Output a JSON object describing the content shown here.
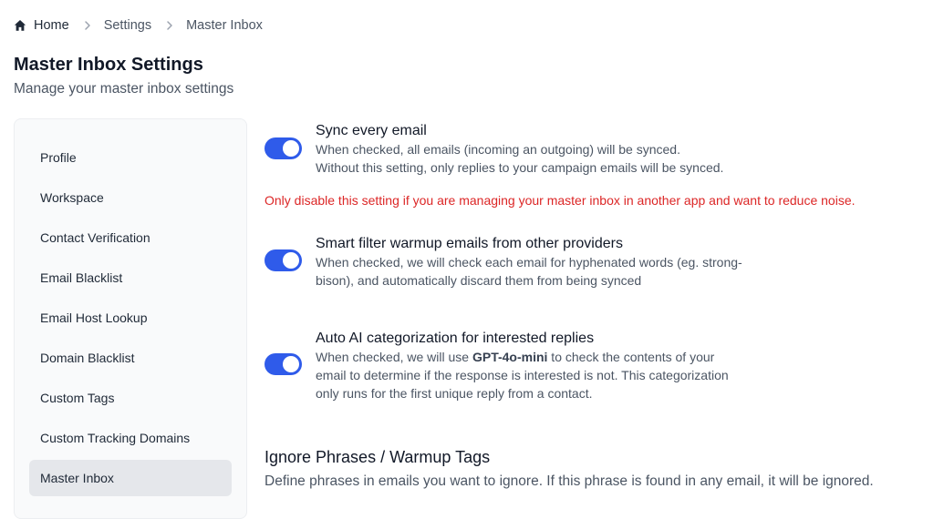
{
  "breadcrumb": {
    "home": "Home",
    "settings": "Settings",
    "current": "Master Inbox"
  },
  "header": {
    "title": "Master Inbox Settings",
    "subtitle": "Manage your master inbox settings"
  },
  "sidebar": {
    "items": [
      {
        "label": "Profile",
        "active": false
      },
      {
        "label": "Workspace",
        "active": false
      },
      {
        "label": "Contact Verification",
        "active": false
      },
      {
        "label": "Email Blacklist",
        "active": false
      },
      {
        "label": "Email Host Lookup",
        "active": false
      },
      {
        "label": "Domain Blacklist",
        "active": false
      },
      {
        "label": "Custom Tags",
        "active": false
      },
      {
        "label": "Custom Tracking Domains",
        "active": false
      },
      {
        "label": "Master Inbox",
        "active": true
      }
    ]
  },
  "settings": {
    "sync": {
      "enabled": true,
      "title": "Sync every email",
      "desc_line1": "When checked, all emails (incoming an outgoing) will be synced.",
      "desc_line2": "Without this setting, only replies to your campaign emails will be synced."
    },
    "warning": "Only disable this setting if you are managing your master inbox in another app and want to reduce noise.",
    "smart_filter": {
      "enabled": true,
      "title": "Smart filter warmup emails from other providers",
      "desc_line1": "When checked, we will check each email for hyphenated words (eg. strong-",
      "desc_line2": "bison), and automatically discard them from being synced"
    },
    "auto_ai": {
      "enabled": true,
      "title": "Auto AI categorization for interested replies",
      "desc_line1_pre": "When checked, we will use ",
      "desc_line1_model": "GPT-4o-mini",
      "desc_line1_post": " to check the contents of your",
      "desc_line2": "email to determine if the response is interested is not. This categorization",
      "desc_line3": "only runs for the first unique reply from a contact."
    }
  },
  "ignore_section": {
    "title": "Ignore Phrases / Warmup Tags",
    "desc": "Define phrases in emails you want to ignore. If this phrase is found in any email, it will be ignored."
  },
  "colors": {
    "accent": "#2f5bea",
    "warning": "#dc2626",
    "sidebar_bg": "#f9fafb",
    "active_item_bg": "#e5e7eb"
  },
  "icons": {
    "home": "home-icon",
    "separator": "chevron-right-icon"
  }
}
